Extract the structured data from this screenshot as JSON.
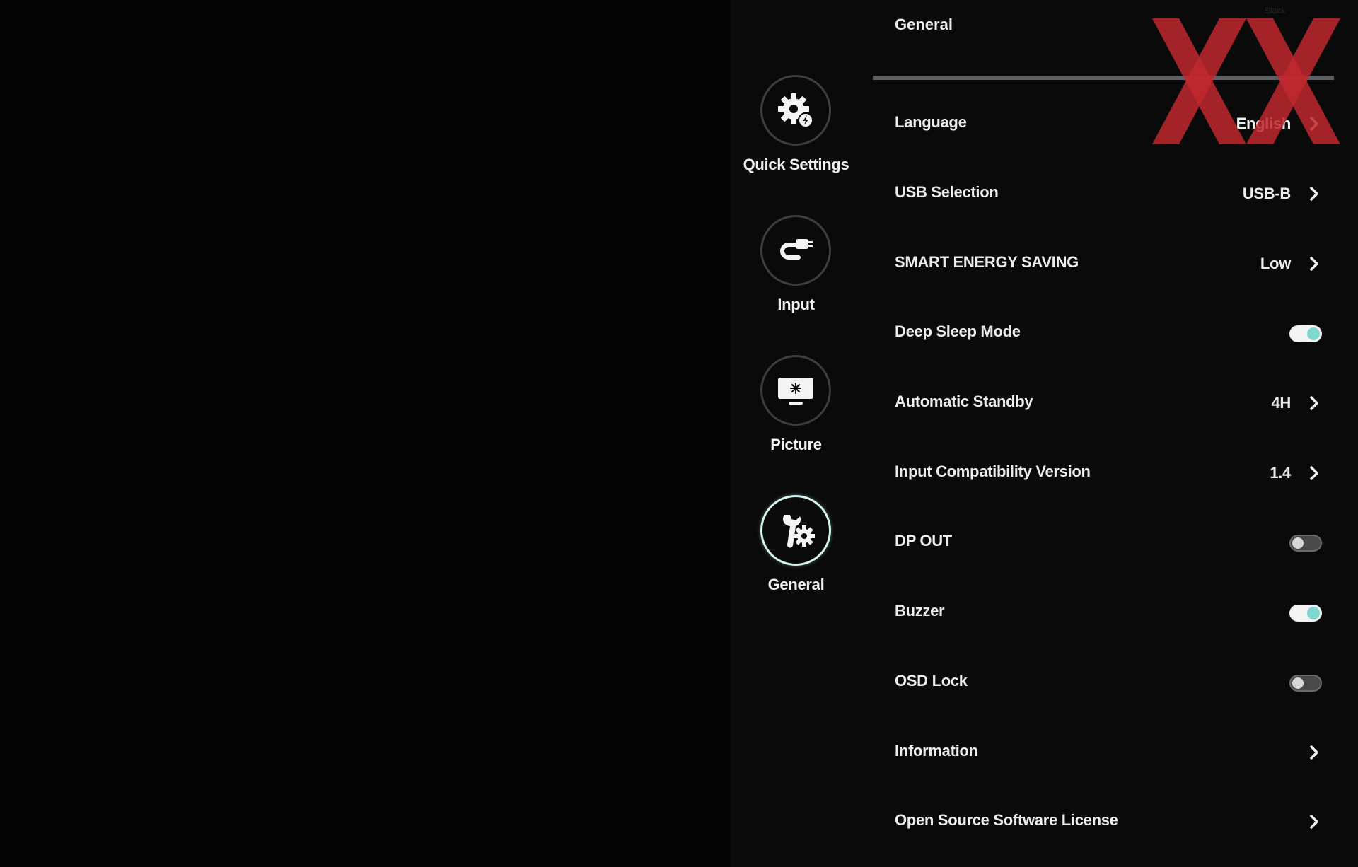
{
  "osd": {
    "panel_title": "General",
    "corner_hint": "Slack",
    "colors": {
      "background": "#000000",
      "text": "#ececec",
      "toggle_on_knob": "#7fd8d0",
      "active_ring": "#d6f3f1",
      "watermark": "#c0282e"
    },
    "nav": [
      {
        "label": "Quick Settings",
        "icon": "gear-lightning-icon",
        "active": false
      },
      {
        "label": "Input",
        "icon": "input-cable-icon",
        "active": false
      },
      {
        "label": "Picture",
        "icon": "monitor-icon",
        "active": false
      },
      {
        "label": "General",
        "icon": "wrench-gear-icon",
        "active": true
      }
    ],
    "settings": [
      {
        "label": "Language",
        "value": "English",
        "control": "chevron"
      },
      {
        "label": "USB Selection",
        "value": "USB-B",
        "control": "chevron"
      },
      {
        "label": "SMART ENERGY SAVING",
        "value": "Low",
        "control": "chevron"
      },
      {
        "label": "Deep Sleep Mode",
        "value": "",
        "control": "toggle",
        "state": "on"
      },
      {
        "label": "Automatic Standby",
        "value": "4H",
        "control": "chevron"
      },
      {
        "label": "Input Compatibility Version",
        "value": "1.4",
        "control": "chevron"
      },
      {
        "label": "DP OUT",
        "value": "",
        "control": "toggle",
        "state": "off"
      },
      {
        "label": "Buzzer",
        "value": "",
        "control": "toggle",
        "state": "on"
      },
      {
        "label": "OSD Lock",
        "value": "",
        "control": "toggle",
        "state": "off"
      },
      {
        "label": "Information",
        "value": "",
        "control": "chevron"
      },
      {
        "label": "Open Source Software License",
        "value": "",
        "control": "chevron"
      }
    ]
  }
}
